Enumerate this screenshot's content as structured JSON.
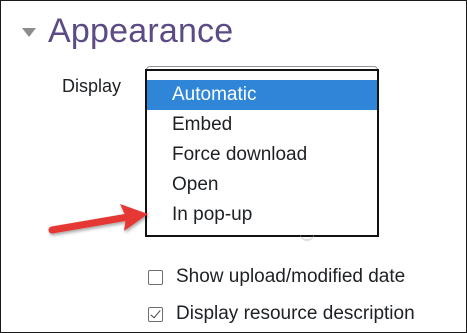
{
  "section": {
    "title": "Appearance"
  },
  "display_field": {
    "label": "Display",
    "options": [
      "Automatic",
      "Embed",
      "Force download",
      "Open",
      "In pop-up"
    ],
    "selected_index": 0
  },
  "checkboxes": {
    "show_upload_modified": {
      "label": "Show upload/modified date",
      "checked": false
    },
    "display_resource_description": {
      "label": "Display resource description",
      "checked": true
    }
  },
  "colors": {
    "section_title": "#5d4b86",
    "selected_option_bg": "#2f86d8",
    "annotation_arrow": "#e53935"
  }
}
